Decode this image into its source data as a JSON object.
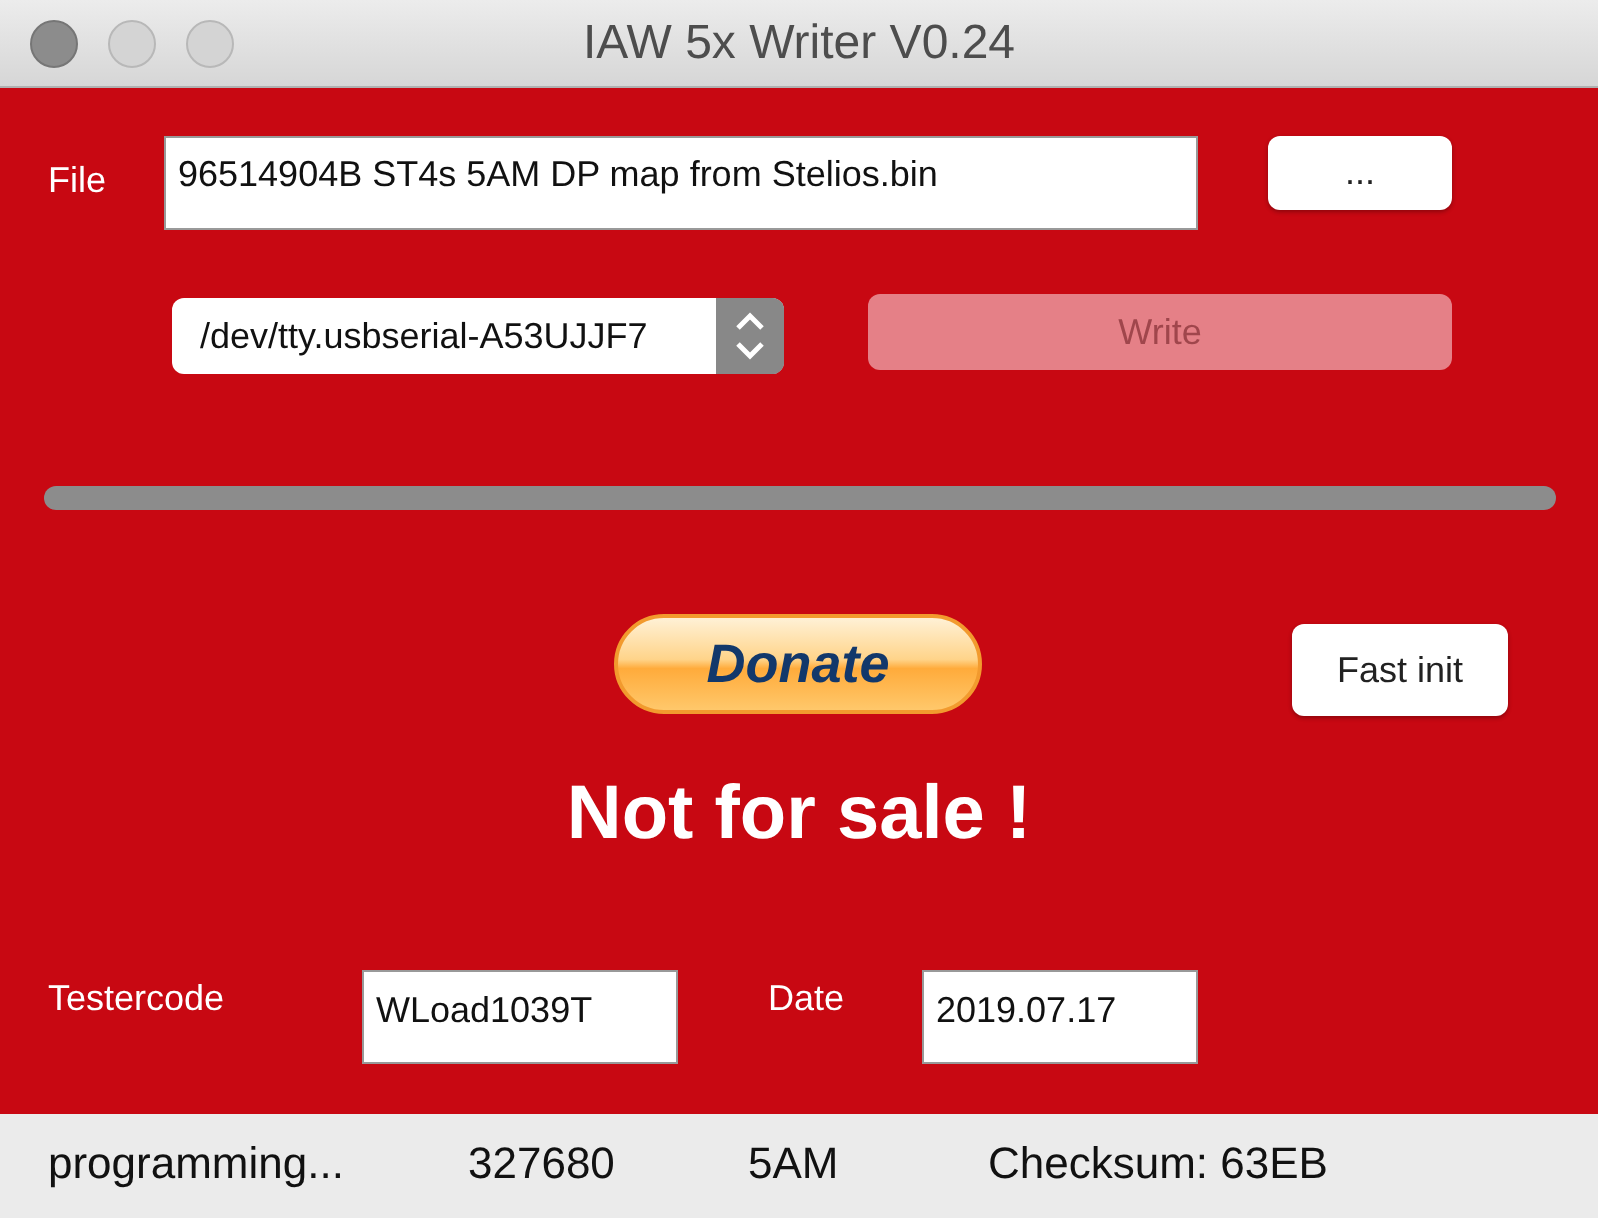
{
  "window": {
    "title": "IAW 5x Writer V0.24"
  },
  "file": {
    "label": "File",
    "value": "96514904B ST4s 5AM DP map from Stelios.bin",
    "browse_button": "..."
  },
  "port": {
    "value": "/dev/tty.usbserial-A53UJJF7"
  },
  "write_button": {
    "label": "Write",
    "disabled": true
  },
  "progress": {
    "level": 0
  },
  "donate_button": {
    "label": "Donate"
  },
  "fast_init_button": {
    "label": "Fast init"
  },
  "notice": "Not for sale !",
  "testercode": {
    "label": "Testercode",
    "value": "WLoad1039T"
  },
  "date": {
    "label": "Date",
    "value": "2019.07.17"
  },
  "status_bar": [
    "programming...",
    "327680",
    "5AM",
    "Checksum: 63EB"
  ]
}
